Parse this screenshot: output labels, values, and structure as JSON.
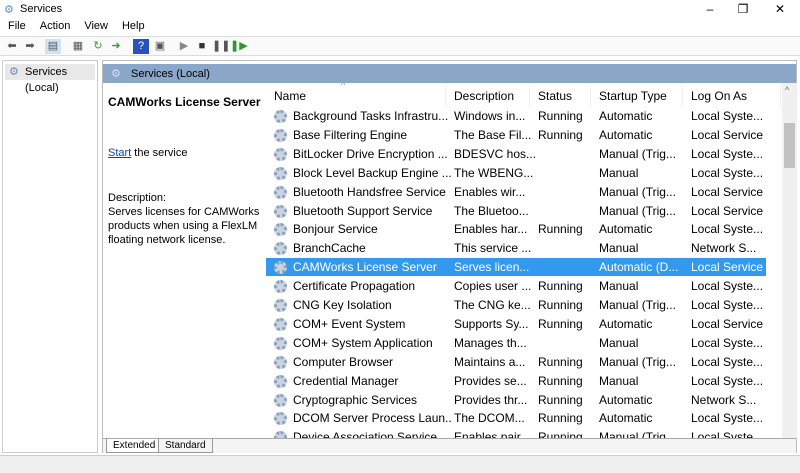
{
  "window": {
    "title": "Services",
    "controls": [
      "–",
      "❐",
      "✕"
    ]
  },
  "menu": [
    "File",
    "Action",
    "View",
    "Help"
  ],
  "toolbar": {
    "icons": [
      "back-icon",
      "forward-icon",
      "show-hide-console-tree-icon",
      "properties-icon",
      "refresh-icon",
      "export-list-icon",
      "help-icon",
      "action-pane-icon",
      "start-service-icon",
      "stop-service-icon",
      "pause-service-icon",
      "restart-service-icon"
    ]
  },
  "tree": {
    "root": "Services (Local)"
  },
  "panel": {
    "title": "Services (Local)"
  },
  "details": {
    "service_name": "CAMWorks License Server",
    "start_link": "Start",
    "start_suffix": " the service",
    "description_label": "Description:",
    "description": "Serves licenses for CAMWorks products when using a FlexLM floating network license."
  },
  "columns": [
    "Name",
    "Description",
    "Status",
    "Startup Type",
    "Log On As"
  ],
  "rows": [
    [
      "Background Tasks Infrastru...",
      "Windows in...",
      "Running",
      "Automatic",
      "Local Syste..."
    ],
    [
      "Base Filtering Engine",
      "The Base Fil...",
      "Running",
      "Automatic",
      "Local Service"
    ],
    [
      "BitLocker Drive Encryption ...",
      "BDESVC hos...",
      "",
      "Manual (Trig...",
      "Local Syste..."
    ],
    [
      "Block Level Backup Engine ...",
      "The WBENG...",
      "",
      "Manual",
      "Local Syste..."
    ],
    [
      "Bluetooth Handsfree Service",
      "Enables wir...",
      "",
      "Manual (Trig...",
      "Local Service"
    ],
    [
      "Bluetooth Support Service",
      "The Bluetoo...",
      "",
      "Manual (Trig...",
      "Local Service"
    ],
    [
      "Bonjour Service",
      "Enables har...",
      "Running",
      "Automatic",
      "Local Syste..."
    ],
    [
      "BranchCache",
      "This service ...",
      "",
      "Manual",
      "Network S..."
    ],
    [
      "CAMWorks License Server",
      "Serves licen...",
      "",
      "Automatic (D...",
      "Local Service"
    ],
    [
      "Certificate Propagation",
      "Copies user ...",
      "Running",
      "Manual",
      "Local Syste..."
    ],
    [
      "CNG Key Isolation",
      "The CNG ke...",
      "Running",
      "Manual (Trig...",
      "Local Syste..."
    ],
    [
      "COM+ Event System",
      "Supports Sy...",
      "Running",
      "Automatic",
      "Local Service"
    ],
    [
      "COM+ System Application",
      "Manages th...",
      "",
      "Manual",
      "Local Syste..."
    ],
    [
      "Computer Browser",
      "Maintains a...",
      "Running",
      "Manual (Trig...",
      "Local Syste..."
    ],
    [
      "Credential Manager",
      "Provides se...",
      "Running",
      "Manual",
      "Local Syste..."
    ],
    [
      "Cryptographic Services",
      "Provides thr...",
      "Running",
      "Automatic",
      "Network S..."
    ],
    [
      "DCOM Server Process Laun...",
      "The DCOM...",
      "Running",
      "Automatic",
      "Local Syste..."
    ],
    [
      "Device Association Service",
      "Enables pair...",
      "Running",
      "Manual (Trig...",
      "Local Syste..."
    ]
  ],
  "selected_row": 8,
  "tabs": [
    "Extended",
    "Standard"
  ],
  "active_tab": 0,
  "colors": {
    "selection": "#3399ee",
    "band": "#8aa6c8",
    "link": "#0645ad"
  }
}
